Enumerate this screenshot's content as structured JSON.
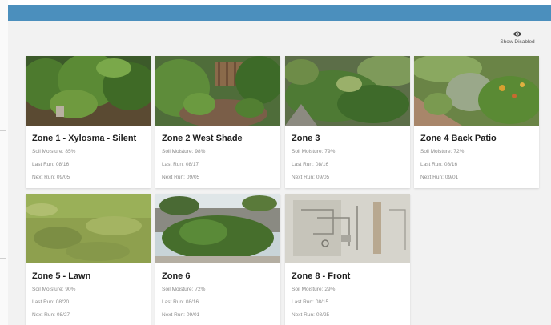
{
  "header": {
    "show_disabled_label": "Show Disabled"
  },
  "labels": {
    "soil_moisture": "Soil Moisture:",
    "last_run": "Last Run:",
    "next_run": "Next Run:"
  },
  "zones": [
    {
      "title": "Zone 1 - Xylosma - Silent",
      "soil_moisture": "85%",
      "last_run": "08/16",
      "next_run": "09/05"
    },
    {
      "title": "Zone 2 West Shade",
      "soil_moisture": "98%",
      "last_run": "08/17",
      "next_run": "09/05"
    },
    {
      "title": "Zone 3",
      "soil_moisture": "79%",
      "last_run": "08/16",
      "next_run": "09/05"
    },
    {
      "title": "Zone 4 Back Patio",
      "soil_moisture": "72%",
      "last_run": "08/16",
      "next_run": "09/01"
    },
    {
      "title": "Zone 5 - Lawn",
      "soil_moisture": "90%",
      "last_run": "08/20",
      "next_run": "08/27"
    },
    {
      "title": "Zone 6",
      "soil_moisture": "72%",
      "last_run": "08/16",
      "next_run": "09/01"
    },
    {
      "title": "Zone 8 - Front",
      "soil_moisture": "29%",
      "last_run": "08/15",
      "next_run": "08/25"
    }
  ]
}
